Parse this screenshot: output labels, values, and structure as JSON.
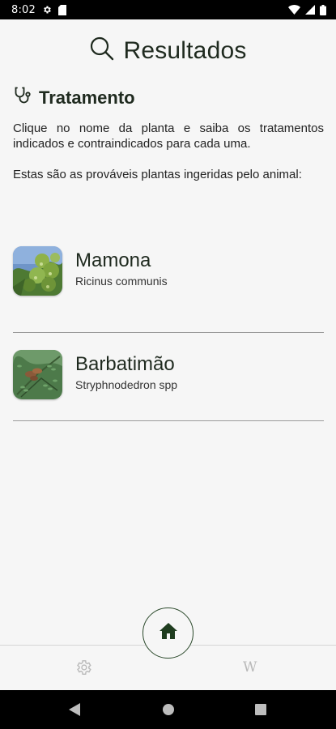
{
  "status_bar": {
    "time": "8:02",
    "icons": [
      "gear-icon",
      "sd-card-icon",
      "wifi-icon",
      "signal-icon",
      "battery-icon"
    ]
  },
  "header": {
    "icon": "search-icon",
    "title": "Resultados"
  },
  "section": {
    "icon": "stethoscope-icon",
    "title": "Tratamento",
    "description": "Clique no nome da planta e saiba os tratamentos indicados e contraindicados para cada uma.",
    "subdescription": "Estas são as prováveis plantas ingeridas pelo animal:"
  },
  "plants": [
    {
      "name": "Mamona",
      "scientific_name": "Ricinus communis",
      "thumbnail": "mamona-photo"
    },
    {
      "name": "Barbatimão",
      "scientific_name": "Stryphnodedron spp",
      "thumbnail": "barbatimao-photo"
    }
  ],
  "bottom_nav": {
    "settings_icon": "gear-icon",
    "home_icon": "home-icon",
    "wiki_label": "W"
  },
  "colors": {
    "accent": "#1f3d1f",
    "divider": "#9a9a9a",
    "background": "#f6f6f6"
  }
}
